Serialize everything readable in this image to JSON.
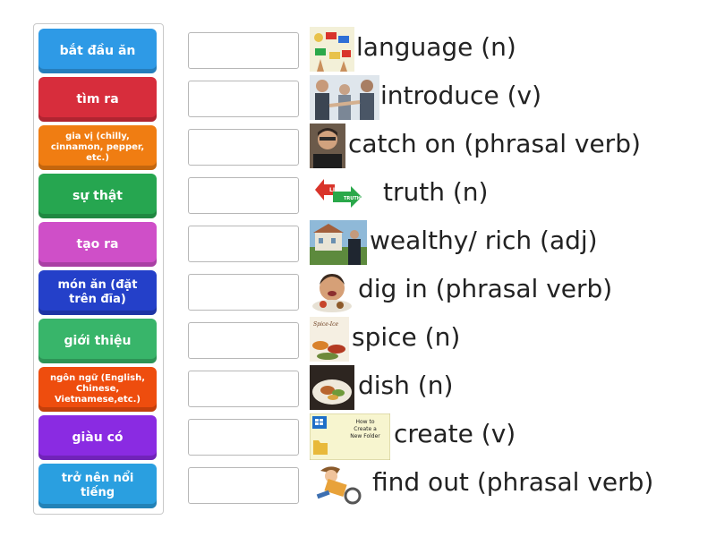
{
  "tiles": [
    {
      "label": "bắt đầu ăn",
      "color": "#2e9ae6"
    },
    {
      "label": "tìm ra",
      "color": "#d72d3c"
    },
    {
      "label": "gia vị (chilly, cinnamon, pepper, etc.)",
      "color": "#f07d12"
    },
    {
      "label": "sự thật",
      "color": "#26a650"
    },
    {
      "label": "tạo ra",
      "color": "#cf4fc8"
    },
    {
      "label": "món ăn (đặt trên đĩa)",
      "color": "#2440c9"
    },
    {
      "label": "giới thiệu",
      "color": "#38b56a"
    },
    {
      "label": "ngôn ngữ (English, Chinese, Vietnamese,etc.)",
      "color": "#ee4d0e"
    },
    {
      "label": "giàu có",
      "color": "#8a2be2"
    },
    {
      "label": "trở nên nổi tiếng",
      "color": "#2a9fe0"
    }
  ],
  "words": [
    {
      "text": "language (n)",
      "icon": "flags-icon"
    },
    {
      "text": "introduce (v)",
      "icon": "handshake-icon"
    },
    {
      "text": "catch on (phrasal verb)",
      "icon": "portrait-icon"
    },
    {
      "text": "truth (n)",
      "icon": "lie-truth-arrows-icon"
    },
    {
      "text": "wealthy/ rich (adj)",
      "icon": "mansion-icon"
    },
    {
      "text": "dig in (phrasal verb)",
      "icon": "eating-icon"
    },
    {
      "text": "spice (n)",
      "icon": "spices-icon"
    },
    {
      "text": "dish (n)",
      "icon": "food-plate-icon"
    },
    {
      "text": "create (v)",
      "icon": "new-folder-icon"
    },
    {
      "text": "find out (phrasal verb)",
      "icon": "detective-icon"
    }
  ],
  "thumb_texts": {
    "lie": "LIE",
    "truth": "TRUTH",
    "spice_brand": "Spice-Ice",
    "folder_line1": "How to",
    "folder_line2": "Create a",
    "folder_line3": "New Folder"
  }
}
